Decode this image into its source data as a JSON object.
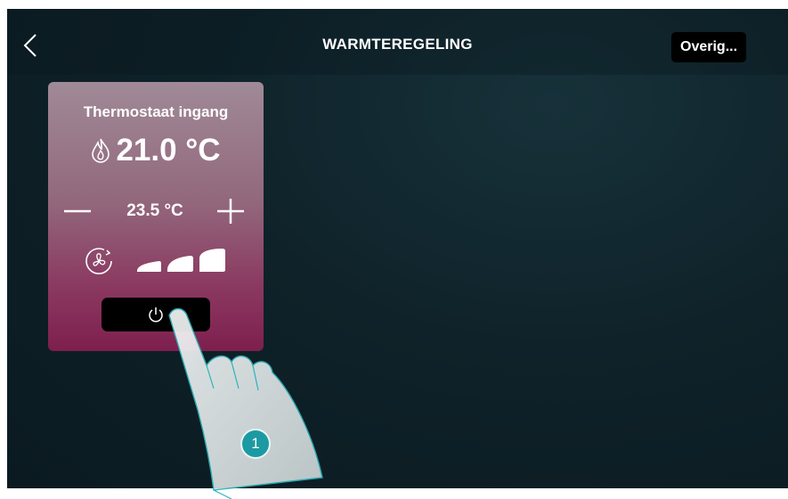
{
  "header": {
    "title": "WARMTEREGELING",
    "more_label": "Overig..."
  },
  "card": {
    "title": "Thermostaat ingang",
    "current_temp": "21.0 °C",
    "setpoint": "23.5 °C",
    "fan_speed_levels": 3,
    "power_icon": "power-icon"
  },
  "annotation": {
    "step": "1"
  },
  "colors": {
    "card_top": "#a08a97",
    "card_bottom": "#7e1f4e",
    "background": "#0f2229",
    "badge": "#1b9aa3"
  }
}
